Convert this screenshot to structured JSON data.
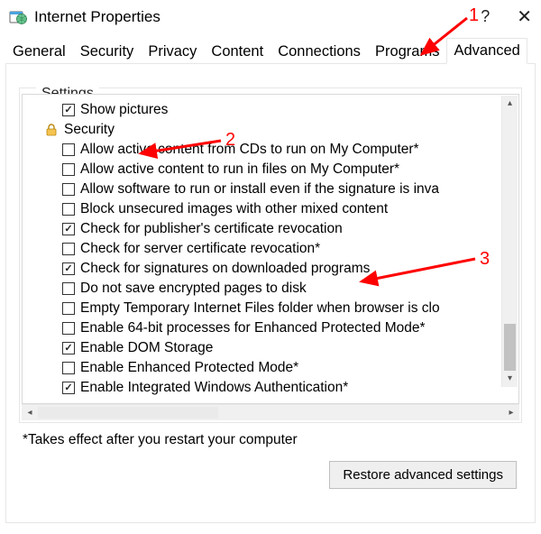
{
  "window": {
    "title": "Internet Properties",
    "help_symbol": "?",
    "close_symbol": "✕"
  },
  "tabs": {
    "items": [
      {
        "label": "General",
        "active": false
      },
      {
        "label": "Security",
        "active": false
      },
      {
        "label": "Privacy",
        "active": false
      },
      {
        "label": "Content",
        "active": false
      },
      {
        "label": "Connections",
        "active": false
      },
      {
        "label": "Programs",
        "active": false
      },
      {
        "label": "Advanced",
        "active": true
      }
    ]
  },
  "settings": {
    "title": "Settings",
    "rows": [
      {
        "type": "checkbox",
        "checked": true,
        "label": "Show pictures"
      },
      {
        "type": "section",
        "icon": "lock",
        "label": "Security"
      },
      {
        "type": "checkbox",
        "checked": false,
        "label": "Allow active content from CDs to run on My Computer*"
      },
      {
        "type": "checkbox",
        "checked": false,
        "label": "Allow active content to run in files on My Computer*"
      },
      {
        "type": "checkbox",
        "checked": false,
        "label": "Allow software to run or install even if the signature is inva"
      },
      {
        "type": "checkbox",
        "checked": false,
        "label": "Block unsecured images with other mixed content"
      },
      {
        "type": "checkbox",
        "checked": true,
        "label": "Check for publisher's certificate revocation"
      },
      {
        "type": "checkbox",
        "checked": false,
        "label": "Check for server certificate revocation*"
      },
      {
        "type": "checkbox",
        "checked": true,
        "label": "Check for signatures on downloaded programs"
      },
      {
        "type": "checkbox",
        "checked": false,
        "label": "Do not save encrypted pages to disk"
      },
      {
        "type": "checkbox",
        "checked": false,
        "label": "Empty Temporary Internet Files folder when browser is clo"
      },
      {
        "type": "checkbox",
        "checked": false,
        "label": "Enable 64-bit processes for Enhanced Protected Mode*"
      },
      {
        "type": "checkbox",
        "checked": true,
        "label": "Enable DOM Storage"
      },
      {
        "type": "checkbox",
        "checked": false,
        "label": "Enable Enhanced Protected Mode*"
      },
      {
        "type": "checkbox",
        "checked": true,
        "label": "Enable Integrated Windows Authentication*"
      }
    ],
    "note": "*Takes effect after you restart your computer",
    "restore_label": "Restore advanced settings"
  },
  "annotations": {
    "num1": "1",
    "num2": "2",
    "num3": "3"
  }
}
